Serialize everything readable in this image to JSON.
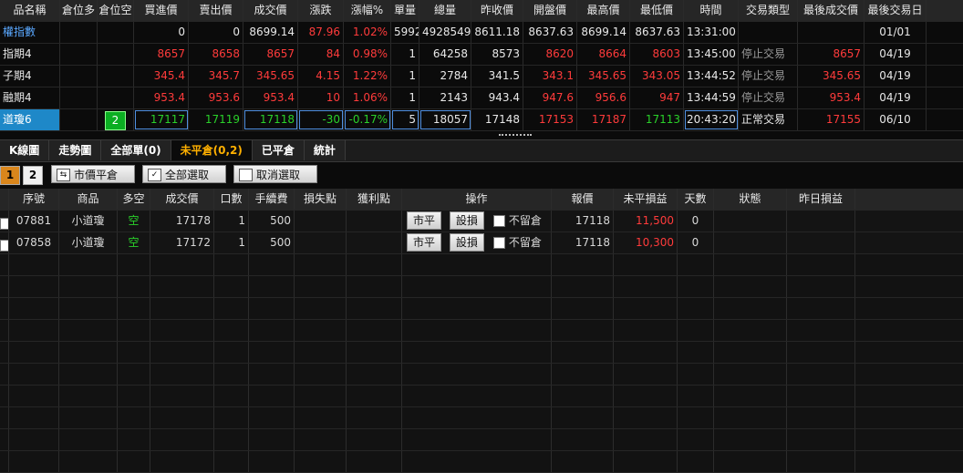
{
  "quote": {
    "headers": [
      "品名稱",
      "倉位多",
      "倉位空",
      "買進價",
      "賣出價",
      "成交價",
      "漲跌",
      "漲幅%",
      "單量",
      "總量",
      "昨收價",
      "開盤價",
      "最高價",
      "最低價",
      "時間",
      "交易類型",
      "最後成交價",
      "最後交易日"
    ],
    "rows": [
      {
        "name": "權指數",
        "long": "",
        "short": "",
        "bid": "0",
        "ask": "0",
        "last": "8699.14",
        "chg": "87.96",
        "pct": "1.02%",
        "vol": "5992",
        "total": "4928549",
        "prev": "8611.18",
        "open": "8637.63",
        "high": "8699.14",
        "low": "8637.63",
        "time": "13:31:00",
        "type": "",
        "lastp": "",
        "lastd": "01/01"
      },
      {
        "name": "指期4",
        "long": "",
        "short": "",
        "bid": "8657",
        "ask": "8658",
        "last": "8657",
        "chg": "84",
        "pct": "0.98%",
        "vol": "1",
        "total": "64258",
        "prev": "8573",
        "open": "8620",
        "high": "8664",
        "low": "8603",
        "time": "13:45:00",
        "type": "停止交易",
        "lastp": "8657",
        "lastd": "04/19"
      },
      {
        "name": "子期4",
        "long": "",
        "short": "",
        "bid": "345.4",
        "ask": "345.7",
        "last": "345.65",
        "chg": "4.15",
        "pct": "1.22%",
        "vol": "1",
        "total": "2784",
        "prev": "341.5",
        "open": "343.1",
        "high": "345.65",
        "low": "343.05",
        "time": "13:44:52",
        "type": "停止交易",
        "lastp": "345.65",
        "lastd": "04/19"
      },
      {
        "name": "融期4",
        "long": "",
        "short": "",
        "bid": "953.4",
        "ask": "953.6",
        "last": "953.4",
        "chg": "10",
        "pct": "1.06%",
        "vol": "1",
        "total": "2143",
        "prev": "943.4",
        "open": "947.6",
        "high": "956.6",
        "low": "947",
        "time": "13:44:59",
        "type": "停止交易",
        "lastp": "953.4",
        "lastd": "04/19"
      },
      {
        "name": "道瓊6",
        "long": "",
        "short": "2",
        "bid": "17117",
        "ask": "17119",
        "last": "17118",
        "chg": "-30",
        "pct": "-0.17%",
        "vol": "5",
        "total": "18057",
        "prev": "17148",
        "open": "17153",
        "high": "17187",
        "low": "17113",
        "time": "20:43:20",
        "type": "正常交易",
        "lastp": "17155",
        "lastd": "06/10"
      }
    ]
  },
  "tabs": [
    "K線圖",
    "走勢圖",
    "全部單(0)",
    "未平倉(0,2)",
    "已平倉",
    "統計"
  ],
  "toolbar": {
    "page1": "1",
    "page2": "2",
    "market_close": "市價平倉",
    "select_all": "全部選取",
    "deselect": "取消選取"
  },
  "grid": {
    "headers": [
      "序號",
      "商品",
      "多空",
      "成交價",
      "口數",
      "手續費",
      "損失點",
      "獲利點",
      "操作",
      "報價",
      "未平損益",
      "天數",
      "狀態",
      "昨日損益"
    ],
    "rows": [
      {
        "id": "07881",
        "product": "小道瓊",
        "side": "空",
        "price": "17178",
        "qty": "1",
        "fee": "500",
        "loss": "",
        "profit": "",
        "btn_close": "市平",
        "btn_stop": "設損",
        "keep": "不留倉",
        "quote": "17118",
        "pnl": "11,500",
        "days": "0",
        "status": "",
        "ypnl": ""
      },
      {
        "id": "07858",
        "product": "小道瓊",
        "side": "空",
        "price": "17172",
        "qty": "1",
        "fee": "500",
        "loss": "",
        "profit": "",
        "btn_close": "市平",
        "btn_stop": "設損",
        "keep": "不留倉",
        "quote": "17118",
        "pnl": "10,300",
        "days": "0",
        "status": "",
        "ypnl": ""
      }
    ]
  },
  "colors": {
    "up": "#ff3b3b",
    "down": "#2ad12a",
    "active_tab": "#ffb000",
    "selection": "#1e88c8"
  }
}
